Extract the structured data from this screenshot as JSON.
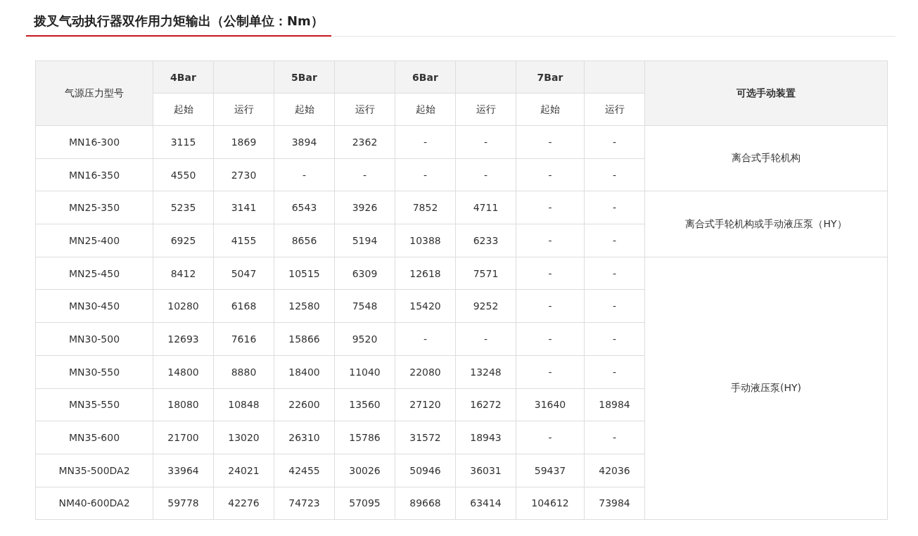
{
  "title": "拨叉气动执行器双作用力矩输出（公制单位：Nm）",
  "table": {
    "model_header": "气源压力型号",
    "pressures": [
      "4Bar",
      "5Bar",
      "6Bar",
      "7Bar"
    ],
    "subheaders": [
      "起始",
      "运行",
      "起始",
      "运行",
      "起始",
      "运行",
      "起始",
      "运行"
    ],
    "manual_header": "可选手动装置",
    "groups": [
      {
        "manual_device": "离合式手轮机构",
        "rows": [
          {
            "model": "MN16-300",
            "values": [
              "3115",
              "1869",
              "3894",
              "2362",
              "-",
              "-",
              "-",
              "-"
            ]
          },
          {
            "model": "MN16-350",
            "values": [
              "4550",
              "2730",
              "-",
              "-",
              "-",
              "-",
              "-",
              "-"
            ]
          }
        ]
      },
      {
        "manual_device": "离合式手轮机构或手动液压泵（HY）",
        "rows": [
          {
            "model": "MN25-350",
            "values": [
              "5235",
              "3141",
              "6543",
              "3926",
              "7852",
              "4711",
              "-",
              "-"
            ]
          },
          {
            "model": "MN25-400",
            "values": [
              "6925",
              "4155",
              "8656",
              "5194",
              "10388",
              "6233",
              "-",
              "-"
            ]
          }
        ]
      },
      {
        "manual_device": "手动液压泵(HY)",
        "rows": [
          {
            "model": "MN25-450",
            "values": [
              "8412",
              "5047",
              "10515",
              "6309",
              "12618",
              "7571",
              "-",
              "-"
            ]
          },
          {
            "model": "MN30-450",
            "values": [
              "10280",
              "6168",
              "12580",
              "7548",
              "15420",
              "9252",
              "-",
              "-"
            ]
          },
          {
            "model": "MN30-500",
            "values": [
              "12693",
              "7616",
              "15866",
              "9520",
              "-",
              "-",
              "-",
              "-"
            ]
          },
          {
            "model": "MN30-550",
            "values": [
              "14800",
              "8880",
              "18400",
              "11040",
              "22080",
              "13248",
              "-",
              "-"
            ]
          },
          {
            "model": "MN35-550",
            "values": [
              "18080",
              "10848",
              "22600",
              "13560",
              "27120",
              "16272",
              "31640",
              "18984"
            ]
          },
          {
            "model": "MN35-600",
            "values": [
              "21700",
              "13020",
              "26310",
              "15786",
              "31572",
              "18943",
              "-",
              "-"
            ]
          },
          {
            "model": "MN35-500DA2",
            "values": [
              "33964",
              "24021",
              "42455",
              "30026",
              "50946",
              "36031",
              "59437",
              "42036"
            ]
          },
          {
            "model": "NM40-600DA2",
            "values": [
              "59778",
              "42276",
              "74723",
              "57095",
              "89668",
              "63414",
              "104612",
              "73984"
            ]
          }
        ]
      }
    ]
  }
}
